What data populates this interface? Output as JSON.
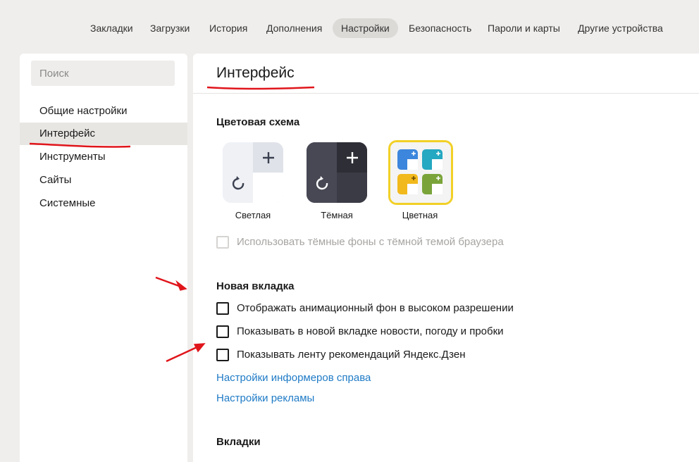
{
  "topnav": {
    "items": [
      "Закладки",
      "Загрузки",
      "История",
      "Дополнения",
      "Настройки",
      "Безопасность",
      "Пароли и карты",
      "Другие устройства"
    ],
    "active_index": 4
  },
  "sidebar": {
    "search_placeholder": "Поиск",
    "items": [
      "Общие настройки",
      "Интерфейс",
      "Инструменты",
      "Сайты",
      "Системные"
    ],
    "active_index": 1
  },
  "main": {
    "title": "Интерфейс",
    "color_scheme": {
      "title": "Цветовая схема",
      "themes": [
        {
          "label": "Светлая",
          "selected": false
        },
        {
          "label": "Тёмная",
          "selected": false
        },
        {
          "label": "Цветная",
          "selected": true
        }
      ],
      "dark_backgrounds_option": {
        "label": "Использовать тёмные фоны с тёмной темой браузера",
        "checked": false,
        "disabled": true
      }
    },
    "new_tab": {
      "title": "Новая вкладка",
      "options": [
        {
          "label": "Отображать анимационный фон в высоком разрешении",
          "checked": false
        },
        {
          "label": "Показывать в новой вкладке новости, погоду и пробки",
          "checked": false
        },
        {
          "label": "Показывать ленту рекомендаций Яндекс.Дзен",
          "checked": false
        }
      ],
      "links": [
        "Настройки информеров справа",
        "Настройки рекламы"
      ]
    },
    "tabs_section": {
      "title": "Вкладки"
    }
  },
  "colors": {
    "page_bg": "#f0eeec",
    "link": "#1f7bc6",
    "annotation": "#e0151b",
    "selected_theme_border": "#f2d027"
  }
}
